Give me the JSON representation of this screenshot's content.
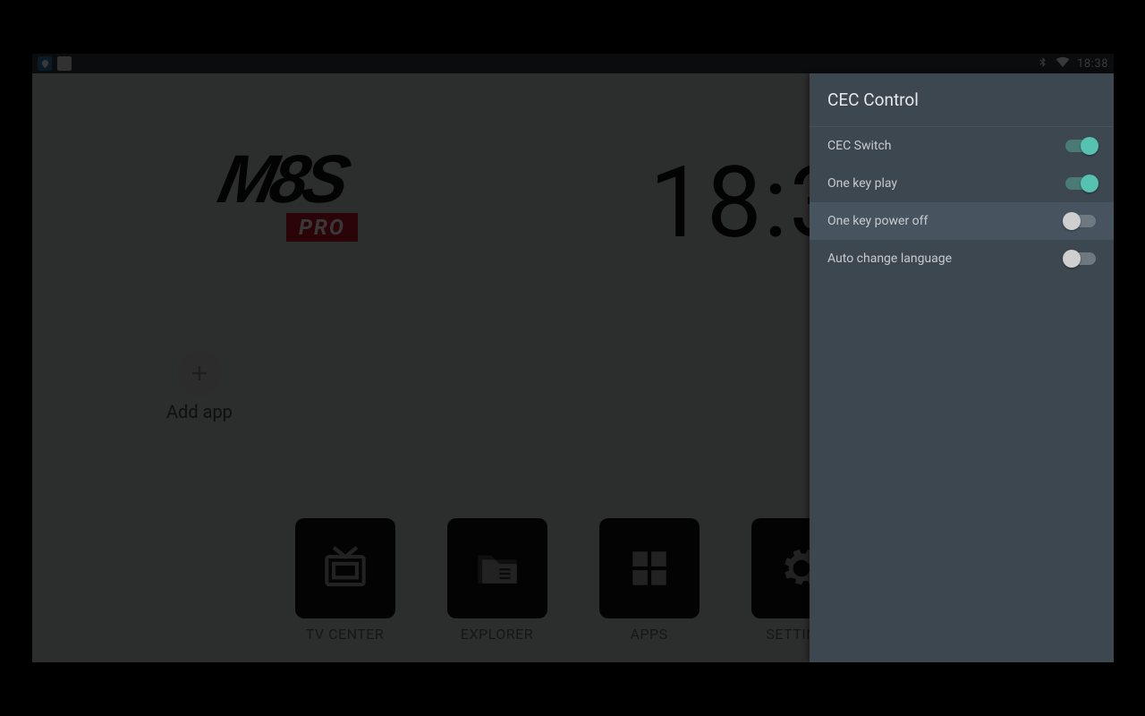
{
  "statusbar": {
    "time": "18:38"
  },
  "launcher": {
    "logo_main": "M8S",
    "logo_sub": "PRO",
    "clock": "18:3",
    "add_app_label": "Add app",
    "dock": [
      {
        "label": "TV CENTER"
      },
      {
        "label": "EXPLORER"
      },
      {
        "label": "APPS"
      },
      {
        "label": "SETTINGS"
      }
    ]
  },
  "panel": {
    "title": "CEC Control",
    "rows": [
      {
        "label": "CEC Switch",
        "on": true,
        "highlight": false
      },
      {
        "label": "One key play",
        "on": true,
        "highlight": false
      },
      {
        "label": "One key power off",
        "on": false,
        "highlight": true
      },
      {
        "label": "Auto change language",
        "on": false,
        "highlight": false
      }
    ]
  }
}
